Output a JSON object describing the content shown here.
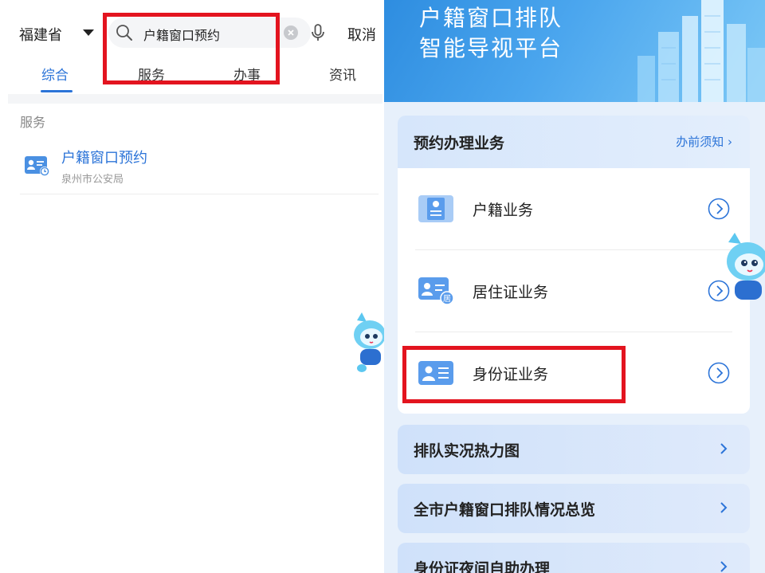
{
  "left": {
    "region": "福建省",
    "search": {
      "query": "户籍窗口预约"
    },
    "cancel_label": "取消",
    "tabs": [
      {
        "label": "综合",
        "active": true
      },
      {
        "label": "服务",
        "active": false
      },
      {
        "label": "办事",
        "active": false
      },
      {
        "label": "资讯",
        "active": false
      }
    ],
    "section_label": "服务",
    "result": {
      "title": "户籍窗口预约",
      "subtitle": "泉州市公安局"
    }
  },
  "right": {
    "banner": {
      "line1": "户籍窗口排队",
      "line2": "智能导视平台"
    },
    "booking": {
      "title": "预约办理业务",
      "link": "办前须知 ›",
      "items": [
        {
          "label": "户籍业务",
          "icon": "household-register-icon"
        },
        {
          "label": "居住证业务",
          "icon": "residence-permit-icon"
        },
        {
          "label": "身份证业务",
          "icon": "id-card-icon"
        }
      ]
    },
    "links": [
      {
        "label": "排队实况热力图"
      },
      {
        "label": "全市户籍窗口排队情况总览"
      },
      {
        "label": "身份证夜间自助办理"
      }
    ]
  },
  "colors": {
    "accent": "#2c74d8",
    "highlight": "#e3141f",
    "banner": "#3b98e6"
  }
}
